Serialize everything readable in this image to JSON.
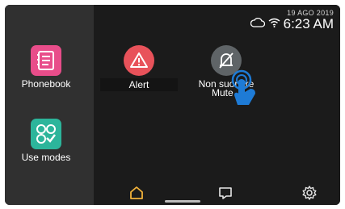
{
  "status": {
    "date": "19 AGO 2019",
    "time": "6:23 AM"
  },
  "sidebar": {
    "phonebook_label": "Phonebook",
    "use_modes_label": "Use modes"
  },
  "main": {
    "alert_label": "Alert",
    "mute_label": "Non suonare",
    "mute_tooltip": "Mute"
  },
  "nav": {
    "items": [
      "home",
      "messages",
      "settings"
    ],
    "active": "home"
  },
  "colors": {
    "accent_home": "#f2b23a",
    "phonebook": "#e84d8a",
    "use_modes": "#2cb59b",
    "alert": "#e8525a",
    "gesture": "#1e7bd6"
  }
}
